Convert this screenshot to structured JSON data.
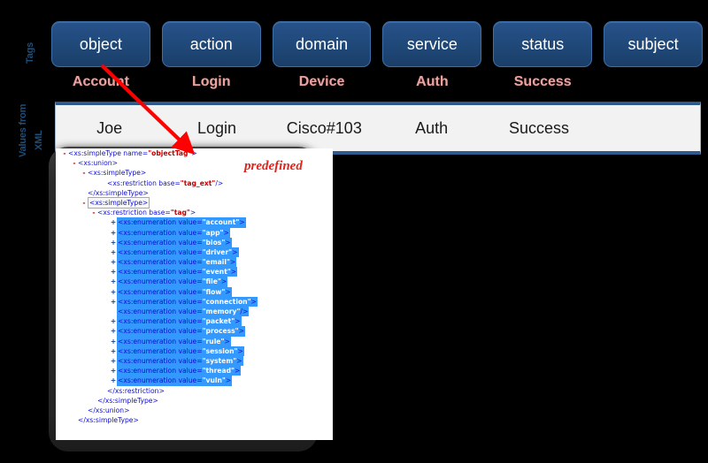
{
  "side_labels": {
    "tags": "Tags",
    "values_from": "Values from",
    "xml": "XML"
  },
  "tag_row": {
    "boxes": [
      {
        "label": "object"
      },
      {
        "label": "action"
      },
      {
        "label": "domain"
      },
      {
        "label": "service"
      },
      {
        "label": "status"
      },
      {
        "label": "subject"
      }
    ]
  },
  "mapping_row": {
    "labels": [
      "Account",
      "Login",
      "Device",
      "Auth",
      "Success",
      ""
    ]
  },
  "data_table": {
    "cells": [
      "Joe",
      "Login",
      "Cisco#103",
      "Auth",
      "Success",
      ""
    ]
  },
  "annotation": {
    "predefined": "predefined"
  },
  "xml_panel": {
    "lines": [
      {
        "indent": 0,
        "toggle": "-",
        "segments": [
          {
            "t": "<xs:simpleType name=",
            "c": "code"
          },
          {
            "t": "\"objectTag\"",
            "c": "aval"
          },
          {
            "t": ">",
            "c": "code"
          }
        ]
      },
      {
        "indent": 1,
        "toggle": "-",
        "segments": [
          {
            "t": "<xs:union>",
            "c": "code"
          }
        ]
      },
      {
        "indent": 2,
        "toggle": "-",
        "segments": [
          {
            "t": "<xs:simpleType>",
            "c": "code"
          }
        ]
      },
      {
        "indent": 4,
        "toggle": "",
        "segments": [
          {
            "t": "<xs:restriction base=",
            "c": "code"
          },
          {
            "t": "\"tag_ext\"",
            "c": "aval"
          },
          {
            "t": "/>",
            "c": "code"
          }
        ]
      },
      {
        "indent": 2,
        "toggle": "",
        "segments": [
          {
            "t": "</xs:simpleType>",
            "c": "code"
          }
        ]
      },
      {
        "indent": 2,
        "toggle": "-",
        "boxed": true,
        "segments": [
          {
            "t": "<xs:simpleType>",
            "c": "code"
          }
        ]
      },
      {
        "indent": 3,
        "toggle": "-",
        "segments": [
          {
            "t": "<xs:restriction base=",
            "c": "code"
          },
          {
            "t": "\"tag\"",
            "c": "aval"
          },
          {
            "t": ">",
            "c": "code"
          }
        ]
      },
      {
        "indent": 5,
        "toggle": "+",
        "hl": true,
        "segments": [
          {
            "t": "<xs:enumeration value=",
            "c": "code"
          },
          {
            "t": "\"account\"",
            "c": "aval"
          },
          {
            "t": ">",
            "c": "code"
          }
        ]
      },
      {
        "indent": 5,
        "toggle": "+",
        "hl": true,
        "segments": [
          {
            "t": "<xs:enumeration value=",
            "c": "code"
          },
          {
            "t": "\"app\"",
            "c": "aval"
          },
          {
            "t": ">",
            "c": "code"
          }
        ]
      },
      {
        "indent": 5,
        "toggle": "+",
        "hl": true,
        "segments": [
          {
            "t": "<xs:enumeration value=",
            "c": "code"
          },
          {
            "t": "\"bios\"",
            "c": "aval"
          },
          {
            "t": ">",
            "c": "code"
          }
        ]
      },
      {
        "indent": 5,
        "toggle": "+",
        "hl": true,
        "segments": [
          {
            "t": "<xs:enumeration value=",
            "c": "code"
          },
          {
            "t": "\"driver\"",
            "c": "aval"
          },
          {
            "t": ">",
            "c": "code"
          }
        ]
      },
      {
        "indent": 5,
        "toggle": "+",
        "hl": true,
        "segments": [
          {
            "t": "<xs:enumeration value=",
            "c": "code"
          },
          {
            "t": "\"email\"",
            "c": "aval"
          },
          {
            "t": ">",
            "c": "code"
          }
        ]
      },
      {
        "indent": 5,
        "toggle": "+",
        "hl": true,
        "segments": [
          {
            "t": "<xs:enumeration value=",
            "c": "code"
          },
          {
            "t": "\"event\"",
            "c": "aval"
          },
          {
            "t": ">",
            "c": "code"
          }
        ]
      },
      {
        "indent": 5,
        "toggle": "+",
        "hl": true,
        "segments": [
          {
            "t": "<xs:enumeration value=",
            "c": "code"
          },
          {
            "t": "\"file\"",
            "c": "aval"
          },
          {
            "t": ">",
            "c": "code"
          }
        ]
      },
      {
        "indent": 5,
        "toggle": "+",
        "hl": true,
        "segments": [
          {
            "t": "<xs:enumeration value=",
            "c": "code"
          },
          {
            "t": "\"flow\"",
            "c": "aval"
          },
          {
            "t": ">",
            "c": "code"
          }
        ]
      },
      {
        "indent": 5,
        "toggle": "+",
        "hl": true,
        "segments": [
          {
            "t": "<xs:enumeration value=",
            "c": "code"
          },
          {
            "t": "\"connection\"",
            "c": "aval"
          },
          {
            "t": ">",
            "c": "code"
          }
        ]
      },
      {
        "indent": 5,
        "toggle": "",
        "hl": true,
        "segments": [
          {
            "t": "<xs:enumeration value=",
            "c": "code"
          },
          {
            "t": "\"memory\"",
            "c": "aval"
          },
          {
            "t": "/>",
            "c": "code"
          }
        ]
      },
      {
        "indent": 5,
        "toggle": "+",
        "hl": true,
        "segments": [
          {
            "t": "<xs:enumeration value=",
            "c": "code"
          },
          {
            "t": "\"packet\"",
            "c": "aval"
          },
          {
            "t": ">",
            "c": "code"
          }
        ]
      },
      {
        "indent": 5,
        "toggle": "+",
        "hl": true,
        "segments": [
          {
            "t": "<xs:enumeration value=",
            "c": "code"
          },
          {
            "t": "\"process\"",
            "c": "aval"
          },
          {
            "t": ">",
            "c": "code"
          }
        ]
      },
      {
        "indent": 5,
        "toggle": "+",
        "hl": true,
        "segments": [
          {
            "t": "<xs:enumeration value=",
            "c": "code"
          },
          {
            "t": "\"rule\"",
            "c": "aval"
          },
          {
            "t": ">",
            "c": "code"
          }
        ]
      },
      {
        "indent": 5,
        "toggle": "+",
        "hl": true,
        "segments": [
          {
            "t": "<xs:enumeration value=",
            "c": "code"
          },
          {
            "t": "\"session\"",
            "c": "aval"
          },
          {
            "t": ">",
            "c": "code"
          }
        ]
      },
      {
        "indent": 5,
        "toggle": "+",
        "hl": true,
        "segments": [
          {
            "t": "<xs:enumeration value=",
            "c": "code"
          },
          {
            "t": "\"system\"",
            "c": "aval"
          },
          {
            "t": ">",
            "c": "code"
          }
        ]
      },
      {
        "indent": 5,
        "toggle": "+",
        "hl": true,
        "segments": [
          {
            "t": "<xs:enumeration value=",
            "c": "code"
          },
          {
            "t": "\"thread\"",
            "c": "aval"
          },
          {
            "t": ">",
            "c": "code"
          }
        ]
      },
      {
        "indent": 5,
        "toggle": "+",
        "hl": true,
        "segments": [
          {
            "t": "<xs:enumeration value=",
            "c": "code"
          },
          {
            "t": "\"vuln\"",
            "c": "aval"
          },
          {
            "t": ">",
            "c": "code"
          }
        ]
      },
      {
        "indent": 4,
        "toggle": "",
        "segments": [
          {
            "t": "</xs:restriction>",
            "c": "code"
          }
        ]
      },
      {
        "indent": 3,
        "toggle": "",
        "segments": [
          {
            "t": "</xs:simpleType>",
            "c": "code"
          }
        ]
      },
      {
        "indent": 2,
        "toggle": "",
        "segments": [
          {
            "t": "</xs:union>",
            "c": "code"
          }
        ]
      },
      {
        "indent": 1,
        "toggle": "",
        "segments": [
          {
            "t": "</xs:simpleType>",
            "c": "code"
          }
        ]
      }
    ]
  },
  "colors": {
    "tag_box": "#1F4878",
    "pink_label": "#E8A3A0",
    "arrow": "#FF0000",
    "highlight": "#3399FF",
    "predefined": "#E8201A",
    "table_border": "#2E5A8E"
  }
}
